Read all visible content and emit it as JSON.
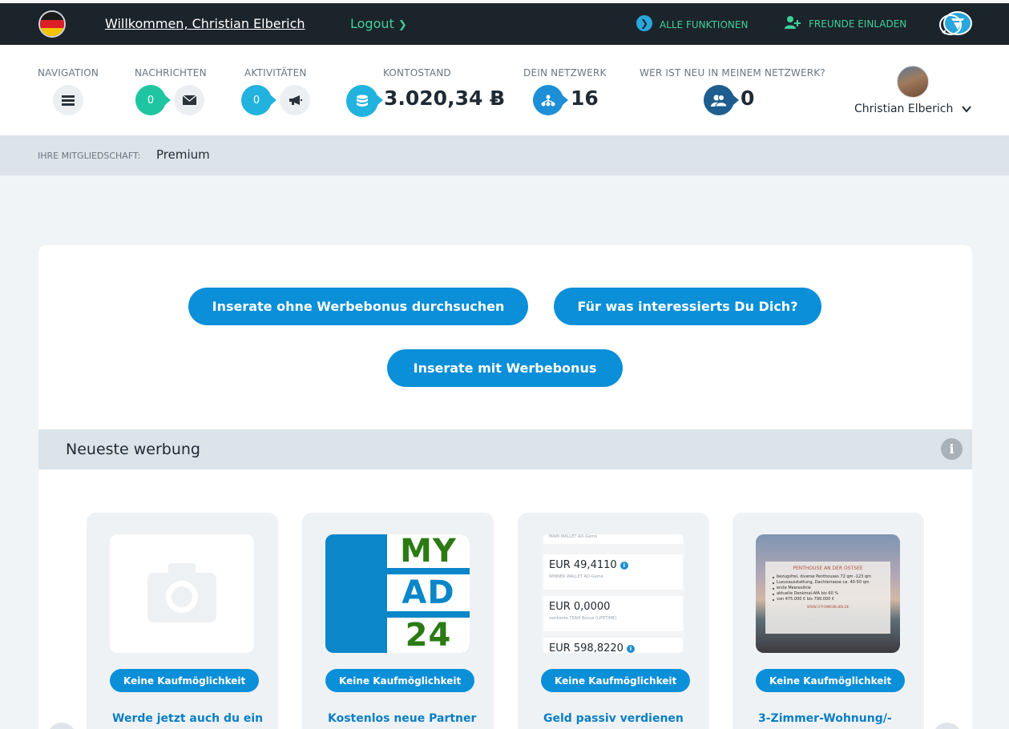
{
  "colors": {
    "topbar_bg": "#1c242b",
    "accent_green": "#3fd09b",
    "primary_blue": "#0b8fd8",
    "teal": "#1fc5a0",
    "navy": "#1e5d8f"
  },
  "topbar": {
    "welcome": "Willkommen, Christian Elberich",
    "logout": "Logout",
    "logout_icon": "chevron-right-icon",
    "all_functions": "ALLE FUNKTIONEN",
    "invite_friends": "FREUNDE EINLADEN",
    "flag_icon": "germany-flag-icon",
    "logo_icon": "brand-chat-logo-icon"
  },
  "stats": {
    "navigation_label": "NAVIGATION",
    "messages_label": "NACHRICHTEN",
    "messages_count": "0",
    "activities_label": "AKTIVITÄTEN",
    "activities_count": "0",
    "balance_label": "KONTOSTAND",
    "balance_value": "3.020,34 Ƀ",
    "network_label": "DEIN NETZWERK",
    "network_count": "16",
    "new_in_network_label": "WER IST NEU IN MEINEM NETZWERK?",
    "new_in_network_count": "0"
  },
  "user": {
    "name": "Christian Elberich"
  },
  "membership": {
    "label": "IHRE MITGLIEDSCHAFT:",
    "value": "Premium"
  },
  "actions": {
    "browse_without_bonus": "Inserate ohne Werbebonus durchsuchen",
    "interests": "Für was interessierts Du Dich?",
    "with_bonus": "Inserate mit Werbebonus"
  },
  "section": {
    "title": "Neueste werbung"
  },
  "cards": [
    {
      "button": "Keine Kaufmöglichkeit",
      "title": "Werde jetzt auch du ein"
    },
    {
      "button": "Keine Kaufmöglichkeit",
      "title": "Kostenlos neue Partner",
      "logo_lines": [
        "MY",
        "AD",
        "24"
      ]
    },
    {
      "button": "Keine Kaufmöglichkeit",
      "title": "Geld passiv verdienen",
      "wallet_top": "MAIN WALLET AD-Game",
      "wallet_rows": [
        {
          "amount": "EUR 49,4110",
          "sub": "WINNER WALLET AD-Game"
        },
        {
          "amount": "EUR  0,0000",
          "sub": "verdiente TEAM Bonus (LIFETIME)"
        },
        {
          "amount": "EUR  598,8220",
          "sub": ""
        }
      ]
    },
    {
      "button": "Keine Kaufmöglichkeit",
      "title": "3-Zimmer-Wohnung/-",
      "image_title": "PENTHOUSE AN DER OSTSEE",
      "image_lines": [
        "bezugsfrei, diverse Penthouses 72 qm -123 qm",
        "Luxusausstattung, Dachterrasse ca. 40-50 qm",
        "erste Meereslinie",
        "aktuelle Denkmal-AfA bis 60 %",
        "von 475.000 € bis 799.000 €"
      ],
      "image_footer": "WWW.CFP-IMMOBILIEN.DE"
    }
  ]
}
